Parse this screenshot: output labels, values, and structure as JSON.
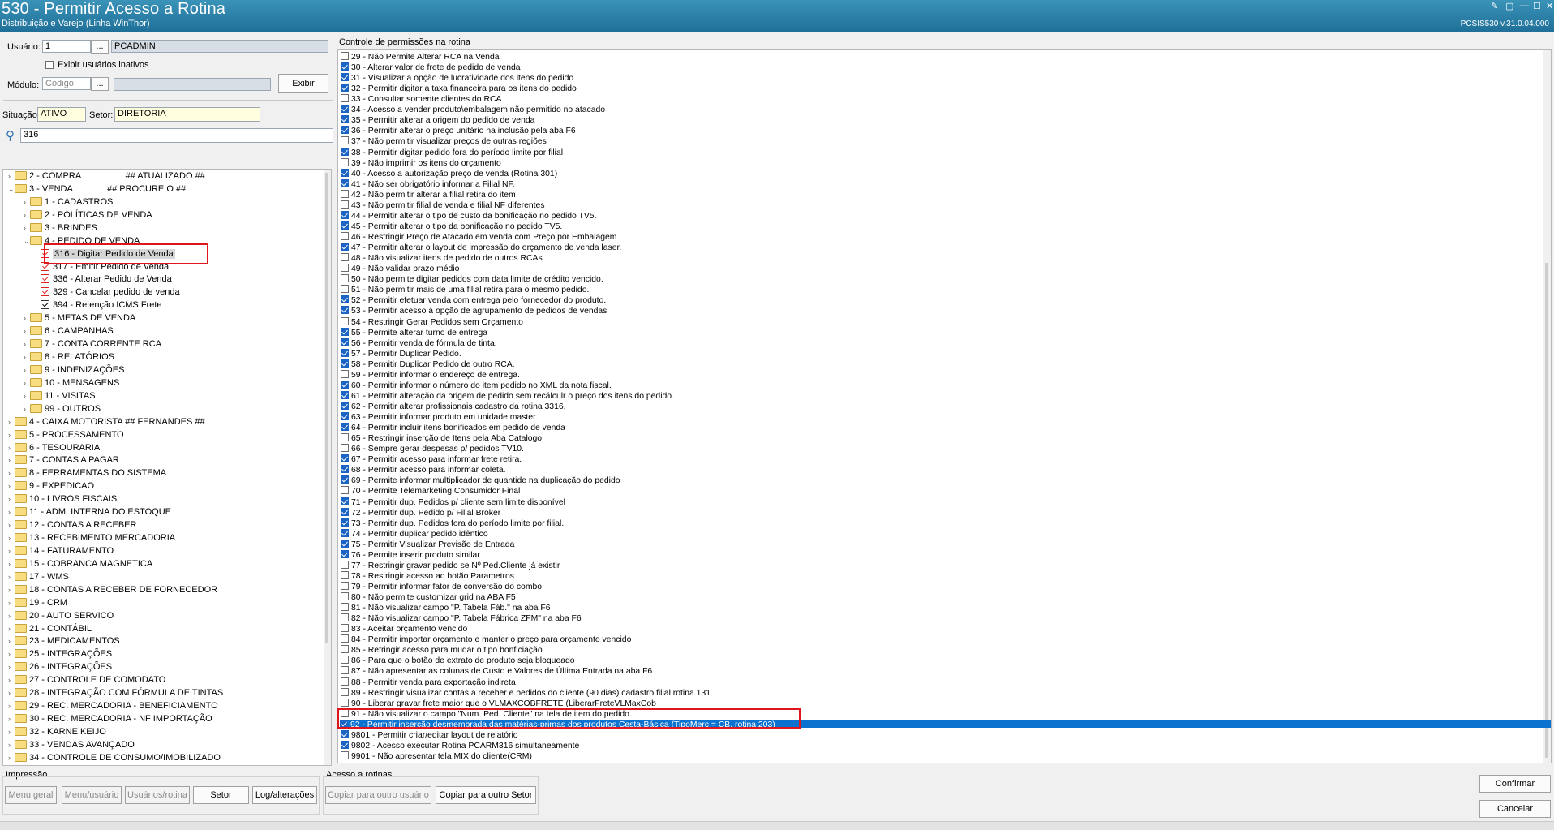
{
  "window": {
    "title": "530 - Permitir Acesso a Rotina",
    "subtitle": "Distribuição e Varejo (Linha WinThor)",
    "version": "PCSIS530  v.31.0.04.000"
  },
  "filters": {
    "usuario_label": "Usuário:",
    "usuario_code": "1",
    "usuario_name": "PCADMIN",
    "browse": "...",
    "exibir_inativos_label": "Exibir usuários inativos",
    "modulo_label": "Módulo:",
    "modulo_placeholder": "Código",
    "exibir_button": "Exibir",
    "situacao_label": "Situação:",
    "situacao_value": "ATIVO",
    "setor_label": "Setor:",
    "setor_value": "DIRETORIA",
    "search_value": "316"
  },
  "tree": [
    {
      "level": 1,
      "label": "2 - COMPRA                  ## ATUALIZADO ##",
      "chev": "›",
      "type": "folder"
    },
    {
      "level": 1,
      "label": "3 - VENDA              ## PROCURE O ##",
      "chev": "⌄",
      "type": "folder"
    },
    {
      "level": 2,
      "label": "1 - CADASTROS",
      "chev": "›",
      "type": "folder"
    },
    {
      "level": 2,
      "label": "2 - POLÍTICAS DE VENDA",
      "chev": "›",
      "type": "folder"
    },
    {
      "level": 2,
      "label": "3 - BRINDES",
      "chev": "›",
      "type": "folder"
    },
    {
      "level": 2,
      "label": "4 - PEDIDO DE VENDA",
      "chev": "⌄",
      "type": "folder"
    },
    {
      "level": 3,
      "label": "316 - Digitar Pedido de Venda",
      "type": "check",
      "red": true,
      "selected": true
    },
    {
      "level": 3,
      "label": "317 - Emitir Pedido de Venda",
      "type": "check",
      "red": true
    },
    {
      "level": 3,
      "label": "336 - Alterar Pedido de Venda",
      "type": "check",
      "red": true
    },
    {
      "level": 3,
      "label": "329 - Cancelar pedido de venda",
      "type": "check",
      "red": true
    },
    {
      "level": 3,
      "label": "394 - Retenção ICMS Frete",
      "type": "check"
    },
    {
      "level": 2,
      "label": "5 - METAS DE VENDA",
      "chev": "›",
      "type": "folder"
    },
    {
      "level": 2,
      "label": "6 - CAMPANHAS",
      "chev": "›",
      "type": "folder"
    },
    {
      "level": 2,
      "label": "7 - CONTA CORRENTE RCA",
      "chev": "›",
      "type": "folder"
    },
    {
      "level": 2,
      "label": "8 - RELATÓRIOS",
      "chev": "›",
      "type": "folder"
    },
    {
      "level": 2,
      "label": "9 - INDENIZAÇÕES",
      "chev": "›",
      "type": "folder"
    },
    {
      "level": 2,
      "label": "10 - MENSAGENS",
      "chev": "›",
      "type": "folder"
    },
    {
      "level": 2,
      "label": "11 - VISITAS",
      "chev": "›",
      "type": "folder"
    },
    {
      "level": 2,
      "label": "99 - OUTROS",
      "chev": "›",
      "type": "folder"
    },
    {
      "level": 1,
      "label": "4 - CAIXA MOTORISTA ## FERNANDES ##",
      "chev": "›",
      "type": "folder"
    },
    {
      "level": 1,
      "label": "5 - PROCESSAMENTO",
      "chev": "›",
      "type": "folder"
    },
    {
      "level": 1,
      "label": "6 - TESOURARIA",
      "chev": "›",
      "type": "folder"
    },
    {
      "level": 1,
      "label": "7 - CONTAS A PAGAR",
      "chev": "›",
      "type": "folder"
    },
    {
      "level": 1,
      "label": "8 - FERRAMENTAS DO SISTEMA",
      "chev": "›",
      "type": "folder"
    },
    {
      "level": 1,
      "label": "9 - EXPEDICAO",
      "chev": "›",
      "type": "folder"
    },
    {
      "level": 1,
      "label": "10 - LIVROS FISCAIS",
      "chev": "›",
      "type": "folder"
    },
    {
      "level": 1,
      "label": "11 - ADM. INTERNA DO ESTOQUE",
      "chev": "›",
      "type": "folder"
    },
    {
      "level": 1,
      "label": "12 - CONTAS A RECEBER",
      "chev": "›",
      "type": "folder"
    },
    {
      "level": 1,
      "label": "13 - RECEBIMENTO MERCADORIA",
      "chev": "›",
      "type": "folder"
    },
    {
      "level": 1,
      "label": "14 - FATURAMENTO",
      "chev": "›",
      "type": "folder"
    },
    {
      "level": 1,
      "label": "15 - COBRANCA MAGNETICA",
      "chev": "›",
      "type": "folder"
    },
    {
      "level": 1,
      "label": "17 - WMS",
      "chev": "›",
      "type": "folder"
    },
    {
      "level": 1,
      "label": "18 - CONTAS A RECEBER DE FORNECEDOR",
      "chev": "›",
      "type": "folder"
    },
    {
      "level": 1,
      "label": "19 - CRM",
      "chev": "›",
      "type": "folder"
    },
    {
      "level": 1,
      "label": "20 - AUTO SERVICO",
      "chev": "›",
      "type": "folder"
    },
    {
      "level": 1,
      "label": "21 - CONTÁBIL",
      "chev": "›",
      "type": "folder"
    },
    {
      "level": 1,
      "label": "23 - MEDICAMENTOS",
      "chev": "›",
      "type": "folder"
    },
    {
      "level": 1,
      "label": "25 - INTEGRAÇÕES",
      "chev": "›",
      "type": "folder"
    },
    {
      "level": 1,
      "label": "26 - INTEGRAÇÕES",
      "chev": "›",
      "type": "folder"
    },
    {
      "level": 1,
      "label": "27 - CONTROLE DE COMODATO",
      "chev": "›",
      "type": "folder"
    },
    {
      "level": 1,
      "label": "28 - INTEGRAÇÃO COM FÓRMULA DE TINTAS",
      "chev": "›",
      "type": "folder"
    },
    {
      "level": 1,
      "label": "29 - REC. MERCADORIA - BENEFICIAMENTO",
      "chev": "›",
      "type": "folder"
    },
    {
      "level": 1,
      "label": "30 - REC. MERCADORIA - NF IMPORTAÇÃO",
      "chev": "›",
      "type": "folder"
    },
    {
      "level": 1,
      "label": "32 - KARNE KEIJO",
      "chev": "›",
      "type": "folder"
    },
    {
      "level": 1,
      "label": "33 - VENDAS AVANÇADO",
      "chev": "›",
      "type": "folder"
    },
    {
      "level": 1,
      "label": "34 - CONTROLE DE CONSUMO/IMOBILIZADO",
      "chev": "›",
      "type": "folder"
    }
  ],
  "permissions_title": "Controle de permissões na rotina",
  "permissions": [
    {
      "label": "29 - Não Permite Alterar RCA na Venda",
      "checked": false
    },
    {
      "label": "30 - Alterar valor de frete de pedido de venda",
      "checked": true
    },
    {
      "label": "31 - Visualizar a opção de lucratividade dos itens do pedido",
      "checked": true
    },
    {
      "label": "32 - Permitir digitar a taxa financeira para os itens do pedido",
      "checked": true
    },
    {
      "label": "33 - Consultar somente clientes do RCA",
      "checked": false
    },
    {
      "label": "34 - Acesso a vender produto\\embalagem não permitido no atacado",
      "checked": true
    },
    {
      "label": "35 - Permitir alterar a origem do pedido de venda",
      "checked": true
    },
    {
      "label": "36 - Permitir alterar o preço unitário na inclusão pela aba F6",
      "checked": true
    },
    {
      "label": "37 - Não permitir visualizar preços de outras regiões",
      "checked": false
    },
    {
      "label": "38 - Permitir digitar pedido fora do período limite por filial",
      "checked": true
    },
    {
      "label": "39 - Não imprimir os itens do orçamento",
      "checked": false
    },
    {
      "label": "40 - Acesso a autorização preço de venda (Rotina 301)",
      "checked": true
    },
    {
      "label": "41 - Não ser obrigatório informar a Filial NF.",
      "checked": true
    },
    {
      "label": "42 - Não permitir alterar a filial retira do item",
      "checked": false
    },
    {
      "label": "43 - Não permitir filial de venda e filial NF diferentes",
      "checked": false
    },
    {
      "label": "44 - Permitir alterar o tipo de custo da bonificação no pedido TV5.",
      "checked": true
    },
    {
      "label": "45 - Permitir alterar o tipo da bonificação no pedido TV5.",
      "checked": true
    },
    {
      "label": "46 - Restringir Preço de Atacado em venda com Preço por Embalagem.",
      "checked": false
    },
    {
      "label": "47 - Permitir alterar o layout de impressão do orçamento de venda laser.",
      "checked": true
    },
    {
      "label": "48 - Não visualizar itens de pedido de outros RCAs.",
      "checked": false
    },
    {
      "label": "49 - Não validar prazo médio",
      "checked": false
    },
    {
      "label": "50 - Não permite digitar pedidos com data limite de crédito vencido.",
      "checked": false
    },
    {
      "label": "51 - Não permitir mais de uma filial retira para o mesmo pedido.",
      "checked": false
    },
    {
      "label": "52 - Permitir efetuar venda com entrega pelo fornecedor do produto.",
      "checked": true
    },
    {
      "label": "53 - Permitir acesso à opção de agrupamento de pedidos de vendas",
      "checked": true
    },
    {
      "label": "54 - Restringir Gerar Pedidos sem Orçamento",
      "checked": false
    },
    {
      "label": "55 - Permite alterar turno de entrega",
      "checked": true
    },
    {
      "label": "56 - Permitir venda de fórmula de tinta.",
      "checked": true
    },
    {
      "label": "57 - Permitir Duplicar Pedido.",
      "checked": true
    },
    {
      "label": "58 - Permitir Duplicar Pedido de outro RCA.",
      "checked": true
    },
    {
      "label": "59 - Permitir informar o endereço de entrega.",
      "checked": false
    },
    {
      "label": "60 - Permitir informar o número do item pedido no XML da nota fiscal.",
      "checked": true
    },
    {
      "label": "61 - Permitir alteração da origem de pedido sem recálculr o preço dos itens do pedido.",
      "checked": true
    },
    {
      "label": "62 - Permitir alterar profissionais cadastro da rotina 3316.",
      "checked": true
    },
    {
      "label": "63 - Permitir informar produto em unidade master.",
      "checked": true
    },
    {
      "label": "64 - Permitir incluir itens bonificados em pedido de venda",
      "checked": true
    },
    {
      "label": "65 - Restringir inserção de Itens pela Aba Catalogo",
      "checked": false
    },
    {
      "label": "66 - Sempre gerar despesas p/ pedidos TV10.",
      "checked": false
    },
    {
      "label": "67 - Permitir acesso para informar frete retira.",
      "checked": true
    },
    {
      "label": "68 - Permitir acesso para informar coleta.",
      "checked": true
    },
    {
      "label": "69 - Permite informar multiplicador de quantide na duplicação do pedido",
      "checked": true
    },
    {
      "label": "70 - Permite Telemarketing Consumidor Final",
      "checked": false
    },
    {
      "label": "71 - Permitir dup. Pedidos p/ cliente sem limite disponível",
      "checked": true
    },
    {
      "label": "72 - Permitir dup. Pedido p/ Filial Broker",
      "checked": true
    },
    {
      "label": "73 - Permitir dup. Pedidos fora do período limite por filial.",
      "checked": true
    },
    {
      "label": "74 - Permitir duplicar pedido idêntico",
      "checked": true
    },
    {
      "label": "75 - Permitir Visualizar Previsão de Entrada",
      "checked": true
    },
    {
      "label": "76 - Permite inserir produto similar",
      "checked": true
    },
    {
      "label": "77 - Restringir gravar pedido se Nº Ped.Cliente já existir",
      "checked": false
    },
    {
      "label": "78 - Restringir acesso ao botão Parametros",
      "checked": false
    },
    {
      "label": "79 - Permitir informar fator de conversão do combo",
      "checked": false
    },
    {
      "label": "80 - Não permite customizar grid na ABA F5",
      "checked": false
    },
    {
      "label": "81 - Não visualizar campo \"P. Tabela Fáb.\" na aba F6",
      "checked": false
    },
    {
      "label": "82 - Não visualizar campo \"P. Tabela Fábrica ZFM\" na aba F6",
      "checked": false
    },
    {
      "label": "83 - Aceitar orçamento vencido",
      "checked": false
    },
    {
      "label": "84 - Permitir importar orçamento e manter o preço para orçamento vencido",
      "checked": false
    },
    {
      "label": "85 - Retringir acesso para mudar o tipo bonficiação",
      "checked": false
    },
    {
      "label": "86 - Para que o botão de extrato de produto seja bloqueado",
      "checked": false
    },
    {
      "label": "87 - Não apresentar as colunas de Custo e Valores de Última Entrada na aba F6",
      "checked": false
    },
    {
      "label": "88 - Permitir venda para exportação indireta",
      "checked": false
    },
    {
      "label": "89 - Restringir visualizar contas a receber e pedidos do cliente (90 dias) cadastro filial rotina 131",
      "checked": false
    },
    {
      "label": "90 - Liberar gravar frete maior que o VLMAXCOBFRETE (LiberarFreteVLMaxCob",
      "checked": false
    },
    {
      "label": "91 - Não visualizar o campo \"Num. Ped. Cliente\" na tela de item do pedido.",
      "checked": false
    },
    {
      "label": "92 - Permitir inserção desmembrada das matérias-primas dos produtos Cesta-Básica (TipoMerc = CB, rotina 203)",
      "checked": true,
      "selected": true
    },
    {
      "label": "9801 - Permitir criar/editar layout de relatório",
      "checked": true
    },
    {
      "label": "9802 - Acesso executar Rotina PCARM316 simultaneamente",
      "checked": true
    },
    {
      "label": "9901 - Não apresentar tela MIX do cliente(CRM)",
      "checked": false
    }
  ],
  "impressao": {
    "title": "Impressão",
    "menu_geral": "Menu geral",
    "menu_usuario": "Menu/usuário",
    "usuarios_rotina": "Usuários/rotina",
    "setor": "Setor",
    "log": "Log/alterações"
  },
  "acesso": {
    "title": "Acesso a rotinas",
    "copiar_usuario": "Copiar para outro usuário",
    "copiar_setor": "Copiar para outro Setor"
  },
  "actions": {
    "confirmar": "Confirmar",
    "cancelar": "Cancelar"
  },
  "colors": {
    "title_bar": "#2a86b0",
    "selection": "#0b72cf",
    "highlight_box": "#e0141b",
    "check": "#1b64c4"
  }
}
